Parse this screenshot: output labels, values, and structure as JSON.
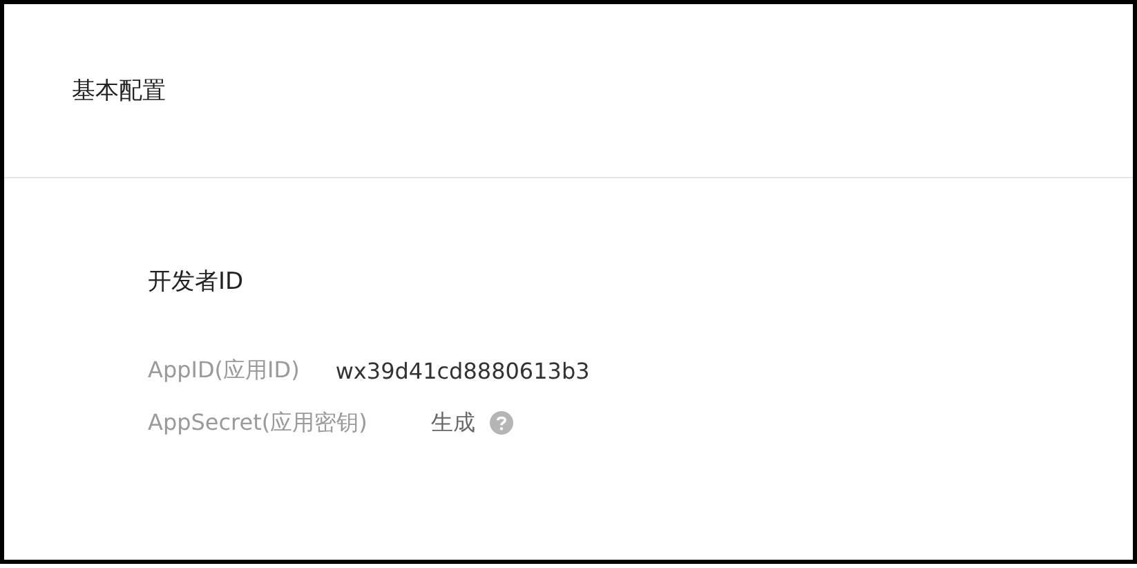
{
  "panel": {
    "title": "基本配置"
  },
  "section": {
    "title": "开发者ID",
    "fields": [
      {
        "label": "AppID(应用ID)",
        "kind": "text",
        "value": "wx39d41cd8880613b3"
      },
      {
        "label": "AppSecret(应用密钥)",
        "kind": "action",
        "value": "生成"
      }
    ]
  }
}
